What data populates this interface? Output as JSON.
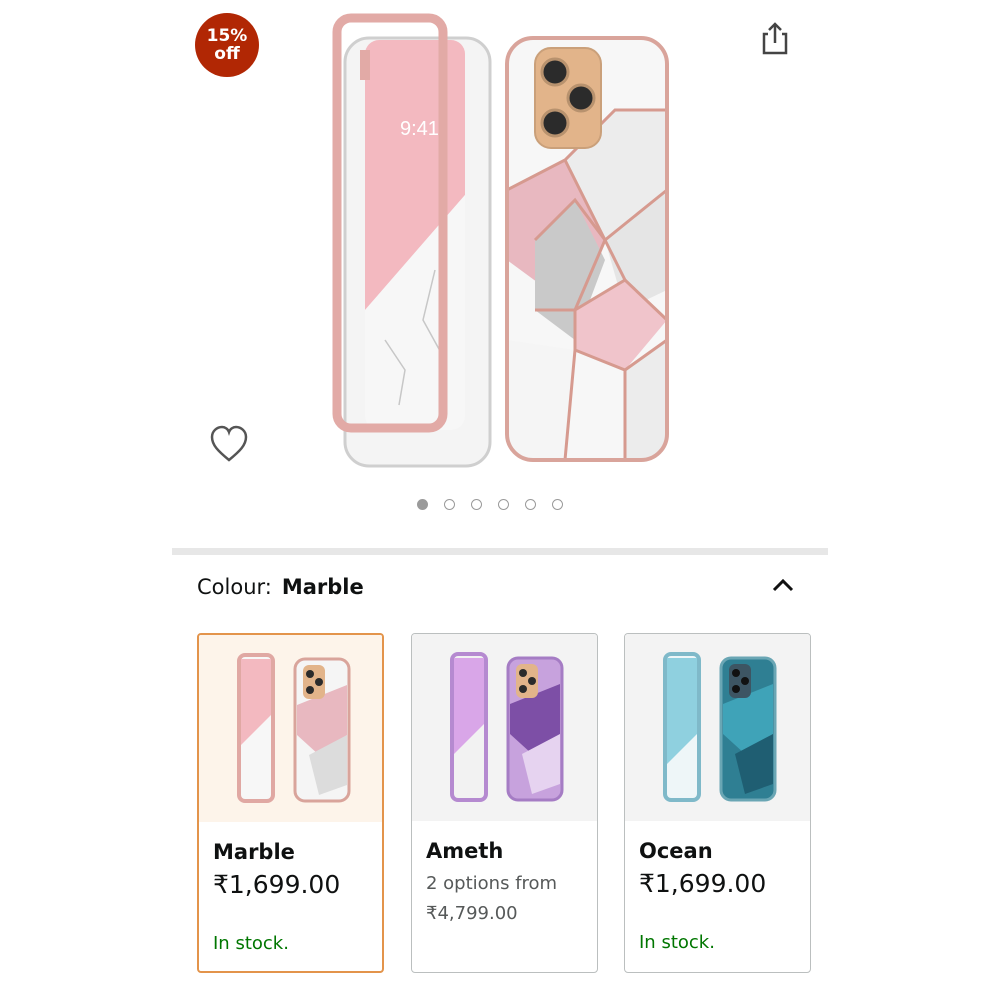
{
  "badge": {
    "line1": "15%",
    "line2": "off"
  },
  "carousel": {
    "total": 6,
    "active_index": 0
  },
  "colour": {
    "label": "Colour:",
    "value": "Marble"
  },
  "options": [
    {
      "name": "Marble",
      "price": "₹1,699.00",
      "stock": "In stock."
    },
    {
      "name": "Ameth",
      "options_text": "2 options from",
      "from_price": "₹4,799.00"
    },
    {
      "name": "Ocean",
      "price": "₹1,699.00",
      "stock": "In stock."
    }
  ],
  "icons": {
    "share": "share-icon",
    "wishlist": "heart-outline-icon",
    "collapse": "chevron-up-icon"
  },
  "colors": {
    "badge": "#b12704",
    "selected_border": "#e3944b",
    "in_stock": "#007600"
  }
}
